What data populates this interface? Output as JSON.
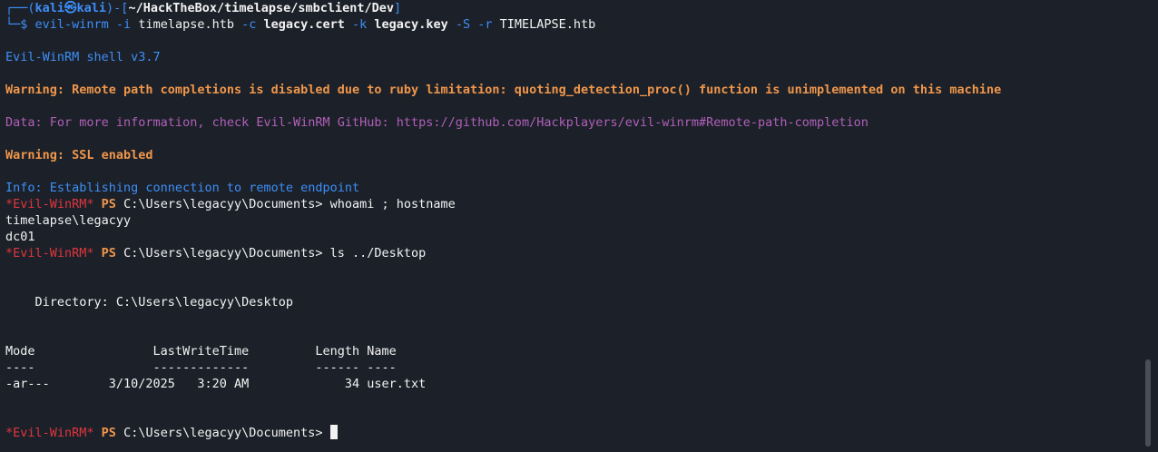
{
  "prompt": {
    "frame_top": "┌──(",
    "user": "kali",
    "at": "㉿",
    "host": "kali",
    "frame_mid": ")-[",
    "path": "~/HackTheBox/timelapse/smbclient/Dev",
    "frame_end": "]",
    "frame_bottom": "└─$ ",
    "cmd": {
      "bin": "evil-winrm",
      "opt_i": " -i ",
      "host": "timelapse.htb",
      "opt_c": " -c ",
      "cert": "legacy.cert",
      "opt_k": " -k ",
      "key": "legacy.key",
      "opt_s": " -S ",
      "opt_r": "-r ",
      "realm": "TIMELAPSE.htb"
    }
  },
  "output": {
    "banner": "Evil-WinRM shell v3.7",
    "warning1": "Warning: Remote path completions is disabled due to ruby limitation: quoting_detection_proc() function is unimplemented on this machine",
    "data_line": "Data: For more information, check Evil-WinRM GitHub: https://github.com/Hackplayers/evil-winrm#Remote-path-completion",
    "warning2": "Warning: SSL enabled",
    "info": "Info: Establishing connection to remote endpoint"
  },
  "ps_prompt": {
    "tag": "*Evil-WinRM*",
    "ps": " PS ",
    "path": "C:\\Users\\legacyy\\Documents> "
  },
  "commands": {
    "c1": "whoami ; hostname",
    "c2": "ls ../Desktop"
  },
  "results": {
    "whoami": "timelapse\\legacyy",
    "hostname": "dc01",
    "directory": "    Directory: C:\\Users\\legacyy\\Desktop",
    "header": "Mode                LastWriteTime         Length Name",
    "dashes": "----                -------------         ------ ----",
    "row": "-ar---        3/10/2025   3:20 AM             34 user.txt"
  },
  "colors": {
    "background": "#1c2129",
    "blue": "#3d8ef7",
    "orange": "#f0964b",
    "purple": "#b05fb9",
    "red": "#e0353d",
    "text": "#f2f2f2"
  }
}
